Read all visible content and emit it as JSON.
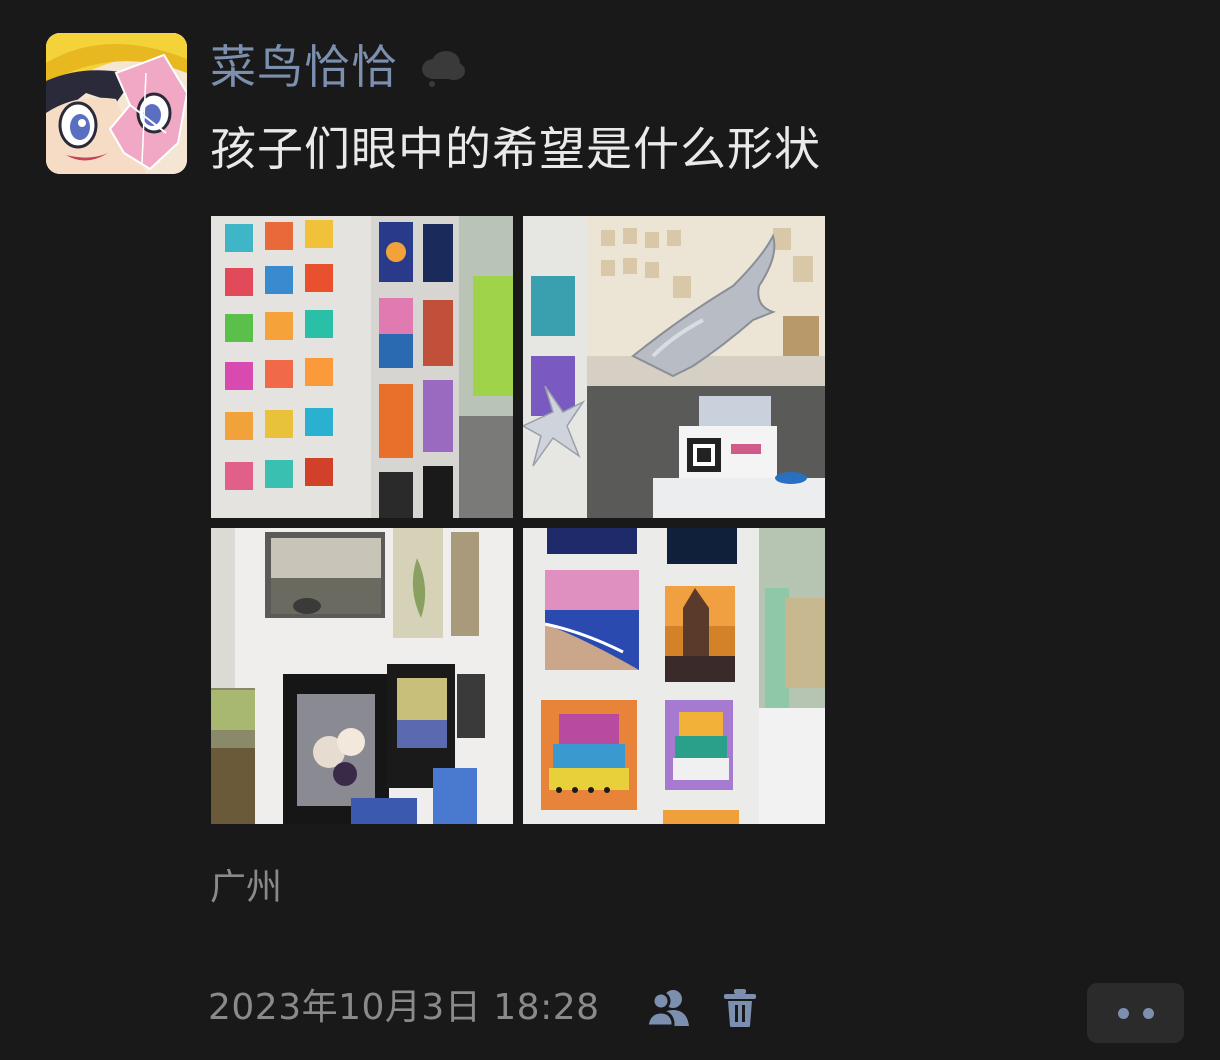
{
  "post": {
    "author_name": "菜鸟恰恰",
    "content": "孩子们眼中的希望是什么形状",
    "location": "广州",
    "timestamp": "2023年10月3日 18:28"
  },
  "icons": {
    "status": "cloud-icon",
    "visibility": "friends-icon",
    "delete": "trash-icon",
    "more": "more-dots-icon"
  },
  "colors": {
    "background": "#191919",
    "name_link": "#7d8fae",
    "body_text": "#e9e9e9",
    "meta_text": "#8a8a8a",
    "more_button_bg": "#2b2b2b"
  }
}
